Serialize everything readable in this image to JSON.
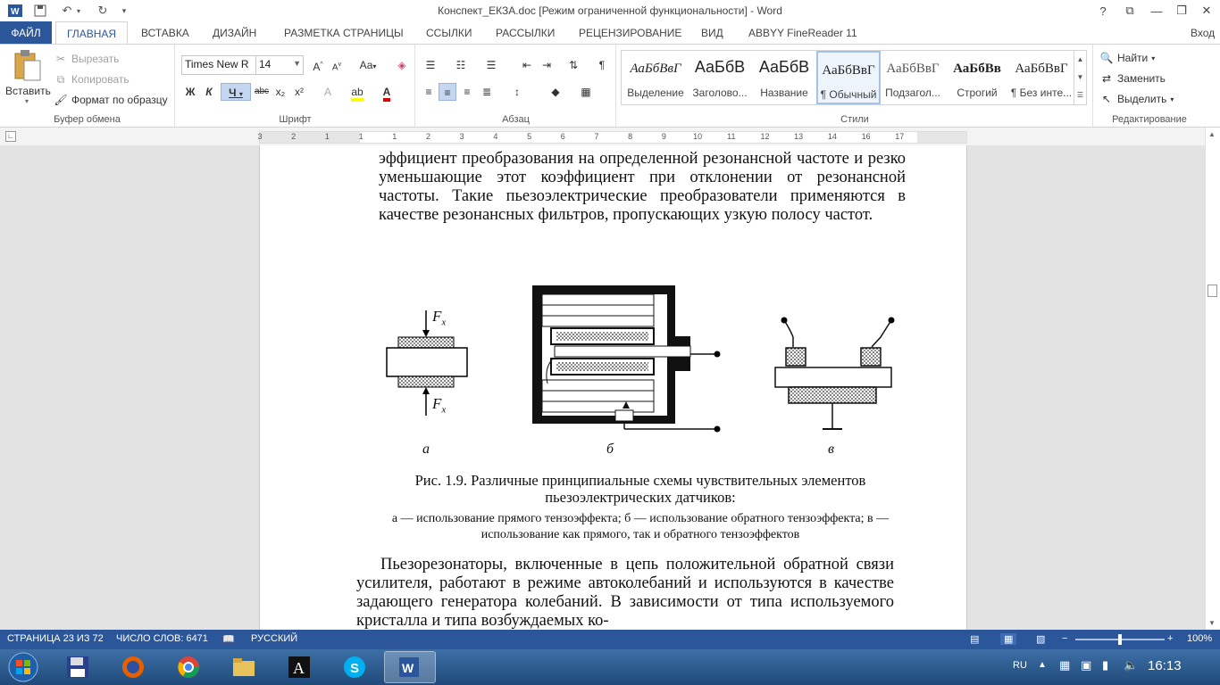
{
  "window": {
    "title": "Конспект_ЕКЗА.doc [Режим ограниченной функциональности] - Word",
    "help": "?",
    "signin": "Вход"
  },
  "tabs": [
    "ФАЙЛ",
    "ГЛАВНАЯ",
    "ВСТАВКА",
    "ДИЗАЙН",
    "РАЗМЕТКА СТРАНИЦЫ",
    "ССЫЛКИ",
    "РАССЫЛКИ",
    "РЕЦЕНЗИРОВАНИЕ",
    "ВИД",
    "ABBYY FineReader 11"
  ],
  "clipboard": {
    "paste": "Вставить",
    "cut": "Вырезать",
    "copy": "Копировать",
    "format_painter": "Формат по образцу",
    "label": "Буфер обмена"
  },
  "font": {
    "name": "Times New R",
    "size": "14",
    "label": "Шрифт",
    "bold": "Ж",
    "italic": "К",
    "underline": "Ч",
    "strike": "abc",
    "sub": "x₂",
    "sup": "x²",
    "case": "Аа"
  },
  "paragraph": {
    "label": "Абзац"
  },
  "styles": {
    "label": "Стили",
    "items": [
      {
        "preview": "АаБбВвГ",
        "name": "Выделение"
      },
      {
        "preview": "АаБбВ",
        "name": "Заголово..."
      },
      {
        "preview": "АаБбВ",
        "name": "Название"
      },
      {
        "preview": "АаБбВвГ",
        "name": "¶ Обычный"
      },
      {
        "preview": "АаБбВвГ",
        "name": "Подзагол..."
      },
      {
        "preview": "АаБбВв",
        "name": "Строгий"
      },
      {
        "preview": "АаБбВвГ",
        "name": "¶ Без инте..."
      }
    ]
  },
  "editing": {
    "label": "Редактирование",
    "find": "Найти",
    "replace": "Заменить",
    "select": "Выделить"
  },
  "ruler": {
    "marks": [
      "3",
      "2",
      "1",
      "1",
      "1",
      "2",
      "3",
      "4",
      "5",
      "6",
      "7",
      "8",
      "9",
      "10",
      "11",
      "12",
      "13",
      "14",
      "16",
      "17"
    ]
  },
  "document": {
    "para1": "эффициент преобразования на определенной резонансной частоте и резко уменьшающие этот коэффициент при отклонении от ре­зонансной частоты. Такие пьезоэлектрические преобразователи применяются в качестве резонансных фильтров, пропускающих узкую полосу частот.",
    "fig_label_a": "а",
    "fig_label_b": "б",
    "fig_label_c": "в",
    "fx": "F",
    "fx_sub": "x",
    "caption": "Рис. 1.9. Различные принципиальные схемы чувствительных элементов пьезоэлектрических датчиков:",
    "caption_note": "а — использование прямого тензоэффекта; б — использование обратного тензо­эффекта; в — использование как прямого, так и обратного тензоэффектов",
    "para2": "Пьезорезонаторы, включенные в цепь положительной обрат­ной связи усилителя, работают в режиме автоколебаний и ис­пользуются в качестве задающего генератора колебаний. В зависи­мости от типа используемого кристалла и типа возбуждаемых ко-"
  },
  "status": {
    "page": "СТРАНИЦА 23 ИЗ 72",
    "words": "ЧИСЛО СЛОВ: 6471",
    "lang": "РУССКИЙ",
    "zoom": "100%"
  },
  "taskbar": {
    "lang": "RU",
    "time": "16:13"
  },
  "colors": {
    "accent": "#2b579a"
  }
}
